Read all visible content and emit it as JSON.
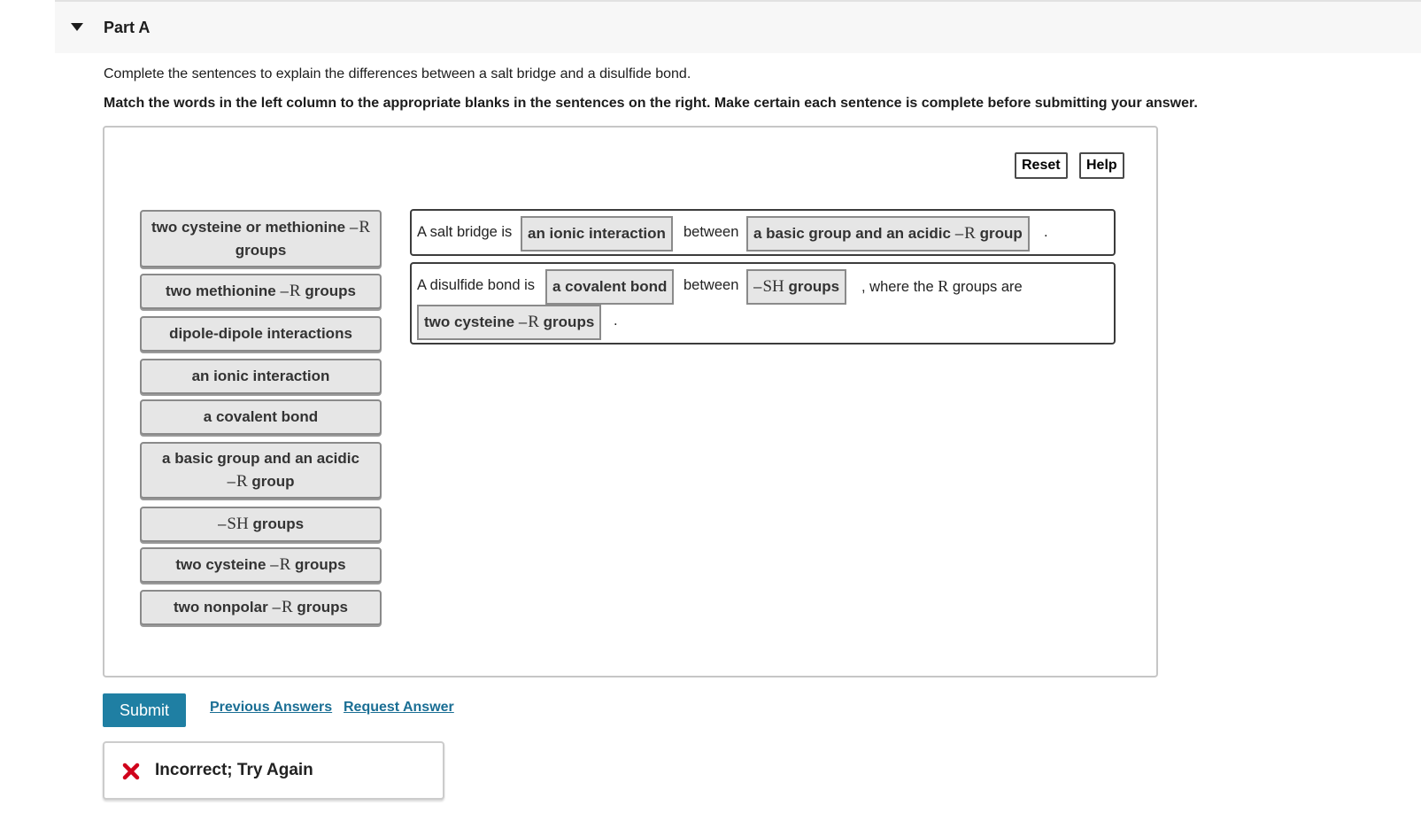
{
  "header": {
    "title": "Part A",
    "toggle_icon": "triangle-down-icon"
  },
  "instructions": {
    "text": "Complete the sentences to explain the differences between a salt bridge and a disulfide bond.",
    "bold_text": "Match the words in the left column to the appropriate blanks in the sentences on the right. Make certain each sentence is complete before submitting your answer."
  },
  "toolbar": {
    "reset_label": "Reset",
    "help_label": "Help"
  },
  "r_symbol": "R",
  "sh_symbol": "SH",
  "tiles": [
    {
      "before": "two cysteine or methionine",
      "after": "groups"
    },
    {
      "before": "two methionine",
      "after": "groups"
    },
    {
      "text": "dipole-dipole interactions"
    },
    {
      "text": "an ionic interaction"
    },
    {
      "text": "a covalent bond"
    },
    {
      "before": "a basic group and an acidic",
      "after": "group"
    },
    {
      "after": "groups"
    },
    {
      "before": "two cysteine",
      "after": "groups"
    },
    {
      "before": "two nonpolar",
      "after": "groups"
    }
  ],
  "sentence1": {
    "prefix": "A salt bridge is",
    "blank1": "an ionic interaction",
    "middle": "between",
    "blank2_before": "a basic group and an acidic",
    "blank2_after": "group",
    "end": "."
  },
  "sentence2": {
    "prefix": "A disulfide bond is",
    "blank1": "a covalent bond",
    "middle": "between",
    "blank2_after": "groups",
    "after_blank2_a": ", where the",
    "after_blank2_b": "groups are",
    "blank3_before": "two cysteine",
    "blank3_after": "groups",
    "end": "."
  },
  "actions": {
    "submit_label": "Submit",
    "previous_answers_label": "Previous Answers",
    "request_answer_label": "Request Answer"
  },
  "feedback": {
    "text": "Incorrect; Try Again",
    "icon": "x-mark-icon",
    "icon_color": "#d0021b"
  },
  "colors": {
    "accent": "#1f7fa3",
    "link": "#1a6e94",
    "tile_bg": "#e6e6e6",
    "error": "#d0021b"
  }
}
